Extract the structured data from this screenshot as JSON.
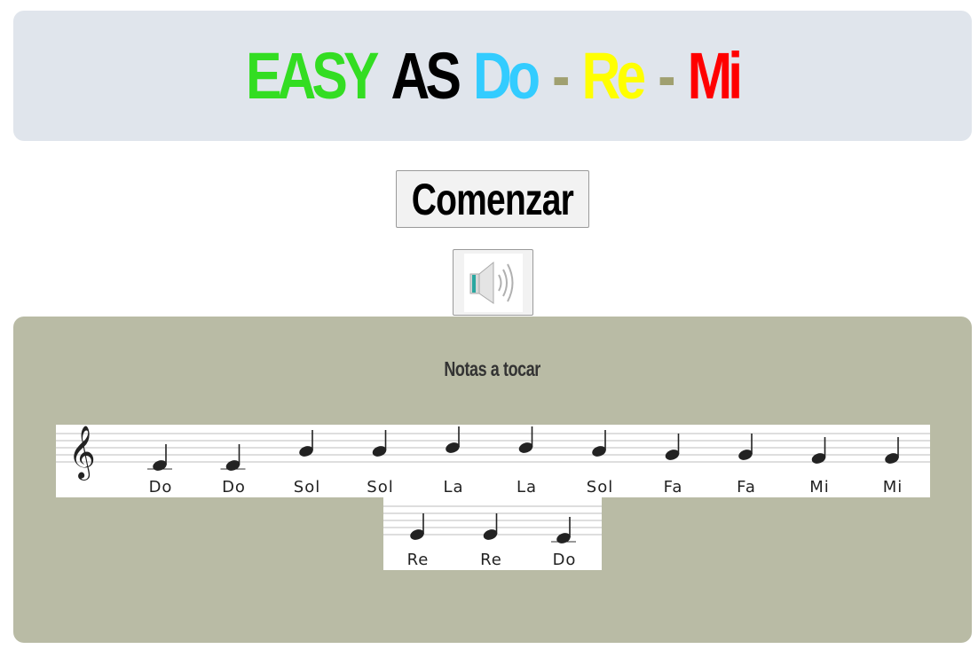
{
  "title": {
    "parts": [
      {
        "text": "EASY",
        "color": "#33dd22"
      },
      {
        "text": "AS",
        "color": "#000000"
      },
      {
        "text": "Do",
        "color": "#33ccff"
      },
      {
        "text": "-",
        "color": "#a0a070"
      },
      {
        "text": "Re",
        "color": "#ffff00"
      },
      {
        "text": "-",
        "color": "#a0a070"
      },
      {
        "text": "Mi",
        "color": "#ff0000"
      }
    ]
  },
  "controls": {
    "start_label": "Comenzar",
    "sound_icon": "speaker-icon"
  },
  "panel": {
    "title": "Notas a tocar",
    "staff_rows": [
      [
        "Do",
        "Do",
        "Sol",
        "Sol",
        "La",
        "La",
        "Sol",
        "Fa",
        "Fa",
        "Mi",
        "Mi"
      ],
      [
        "Re",
        "Re",
        "Do"
      ]
    ]
  },
  "colors": {
    "header_bg": "#e0e5ec",
    "panel_bg": "#b9bba5"
  }
}
